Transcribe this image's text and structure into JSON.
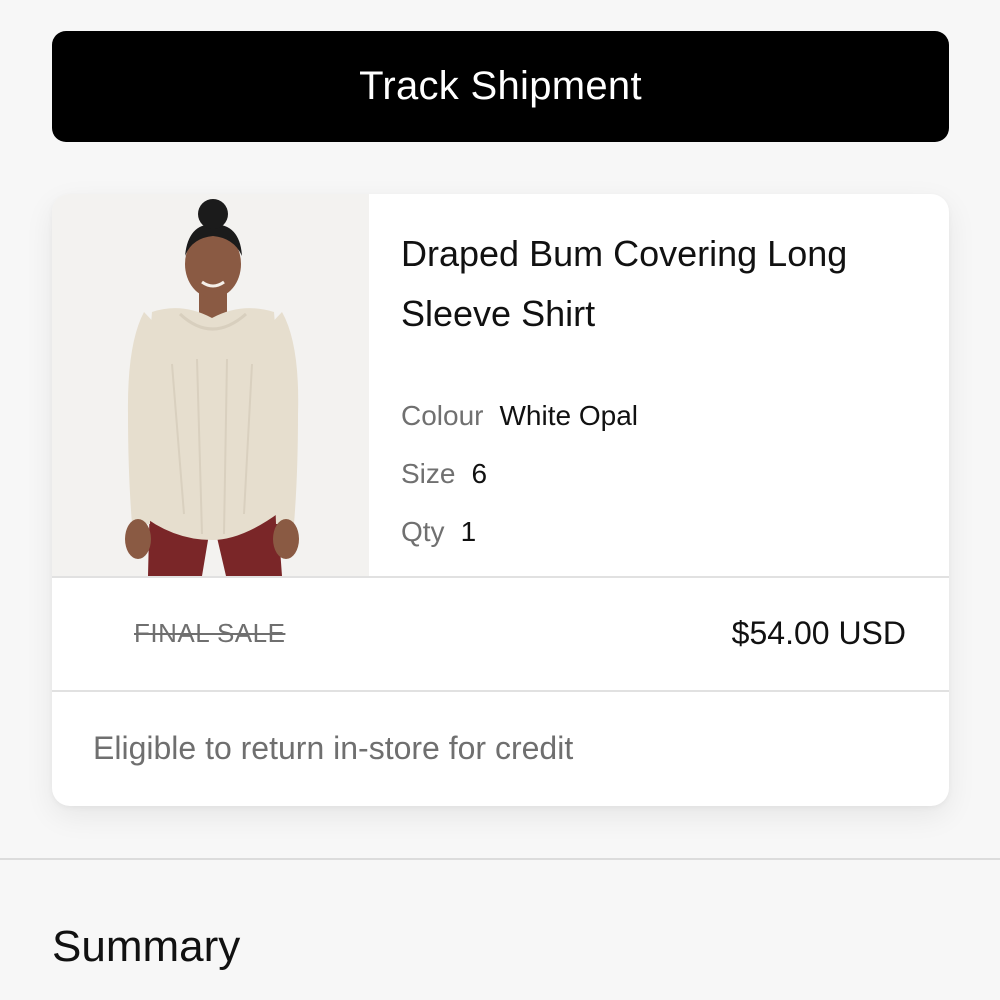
{
  "track_button": {
    "label": "Track Shipment"
  },
  "product": {
    "name": "Draped Bum Covering Long Sleeve Shirt",
    "image_alt": "Woman wearing a White Opal long sleeve shirt with dark red leggings",
    "colour_label": "Colour",
    "colour_value": "White Opal",
    "size_label": "Size",
    "size_value": "6",
    "qty_label": "Qty",
    "qty_value": "1",
    "final_sale_label": "FINAL SALE",
    "price": "$54.00 USD",
    "return_note": "Eligible to return in-store for credit"
  },
  "summary": {
    "title": "Summary"
  },
  "colors": {
    "button_bg": "#000000",
    "button_text": "#ffffff",
    "page_bg": "#f7f7f7",
    "card_bg": "#ffffff",
    "muted_text": "#6f6f6f",
    "garment": "#e6dece",
    "leggings": "#7a2628"
  }
}
